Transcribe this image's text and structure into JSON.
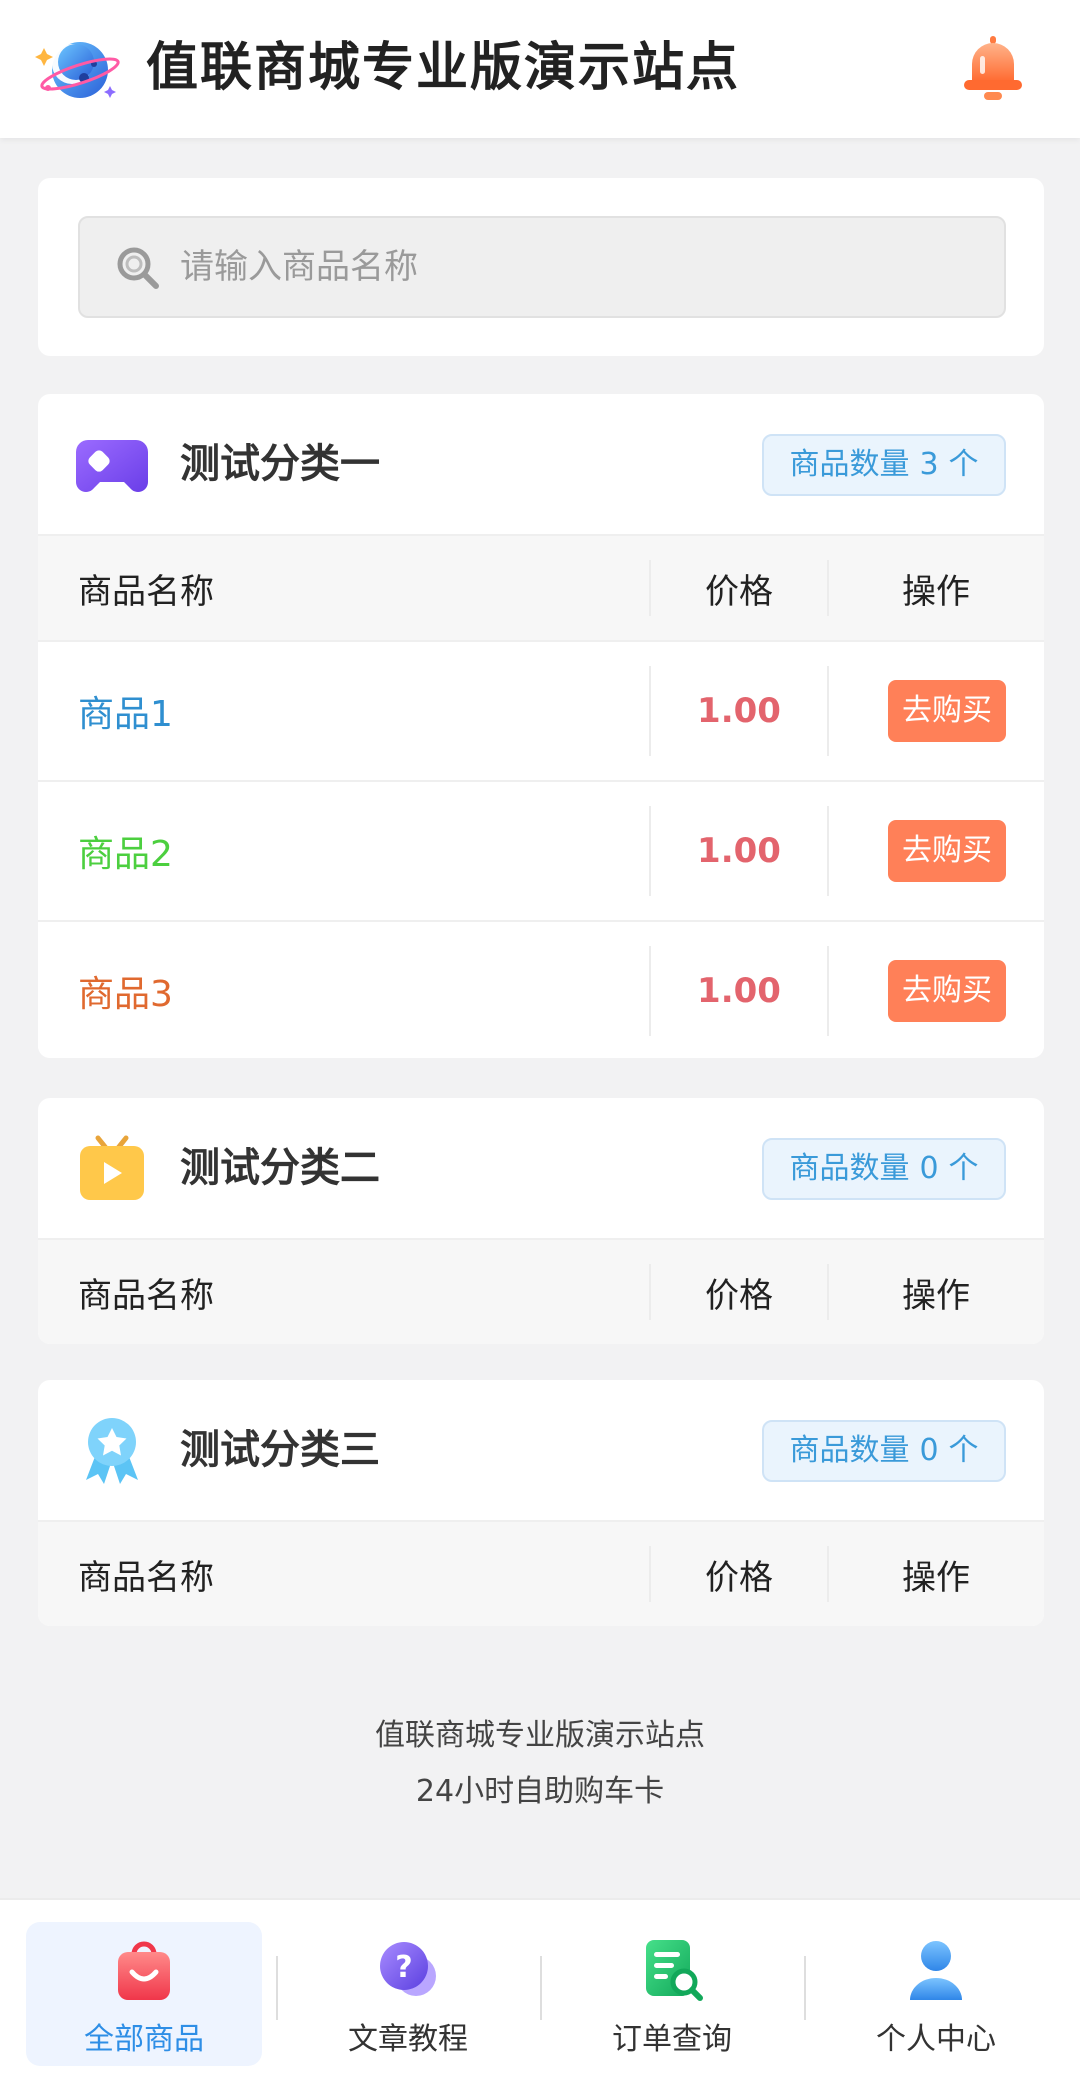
{
  "header": {
    "title": "值联商城专业版演示站点",
    "logo_icon": "moon-planet-logo-icon",
    "bell_icon": "bell-icon"
  },
  "search": {
    "placeholder": "请输入商品名称",
    "value": ""
  },
  "table_headers": {
    "name": "商品名称",
    "price": "价格",
    "action": "操作"
  },
  "categories": [
    {
      "title": "测试分类一",
      "icon": "gamepad-icon",
      "count_prefix": "商品数量",
      "count": "3",
      "count_suffix": "个",
      "products": [
        {
          "name": "商品1",
          "name_color": "#2f8fd0",
          "price": "1.00",
          "action": "去购买"
        },
        {
          "name": "商品2",
          "name_color": "#4ccf3f",
          "price": "1.00",
          "action": "去购买"
        },
        {
          "name": "商品3",
          "name_color": "#e0692f",
          "price": "1.00",
          "action": "去购买"
        }
      ]
    },
    {
      "title": "测试分类二",
      "icon": "tv-play-icon",
      "count_prefix": "商品数量",
      "count": "0",
      "count_suffix": "个",
      "products": []
    },
    {
      "title": "测试分类三",
      "icon": "award-ribbon-icon",
      "count_prefix": "商品数量",
      "count": "0",
      "count_suffix": "个",
      "products": []
    }
  ],
  "footer": {
    "line1": "值联商城专业版演示站点",
    "line2": "24小时自助购车卡"
  },
  "bottom_nav": [
    {
      "label": "全部商品",
      "icon": "shopping-bag-icon",
      "active": true
    },
    {
      "label": "文章教程",
      "icon": "question-chat-icon",
      "active": false
    },
    {
      "label": "订单查询",
      "icon": "order-search-icon",
      "active": false
    },
    {
      "label": "个人中心",
      "icon": "user-icon",
      "active": false
    }
  ],
  "colors": {
    "accent": "#2e8ee6",
    "buy_button": "#ff8058",
    "price": "#e3646d",
    "badge_text": "#3a9ad9"
  }
}
